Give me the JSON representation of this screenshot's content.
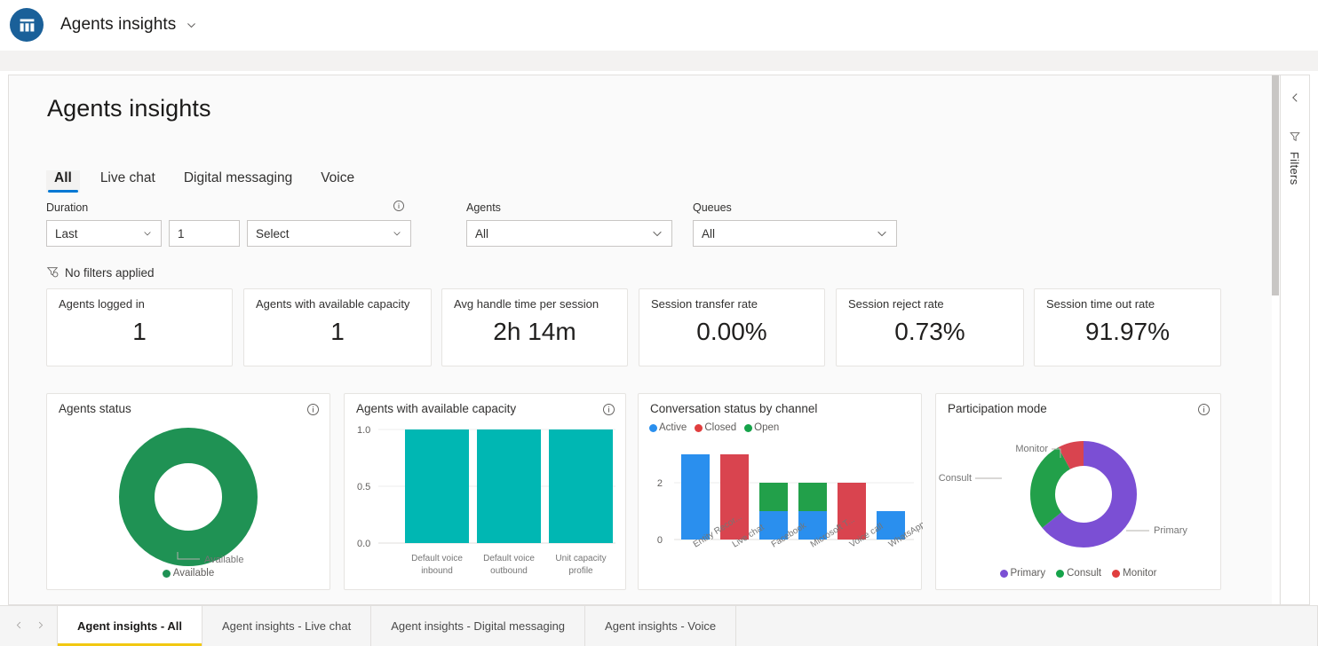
{
  "app": {
    "title": "Agents insights",
    "logo_icon": "analytics-bar-chart-icon",
    "chevron_icon": "chevron-down-icon"
  },
  "page": {
    "title": "Agents insights"
  },
  "tabs": [
    {
      "label": "All",
      "selected": true
    },
    {
      "label": "Live chat",
      "selected": false
    },
    {
      "label": "Digital messaging",
      "selected": false
    },
    {
      "label": "Voice",
      "selected": false
    }
  ],
  "filters": {
    "duration": {
      "label": "Duration",
      "info_icon": "info-icon",
      "operator_value": "Last",
      "number_value": "1",
      "unit_value": "Select",
      "unit_placeholder": "Select"
    },
    "agents": {
      "label": "Agents",
      "value": "All"
    },
    "queues": {
      "label": "Queues",
      "value": "All"
    },
    "applied_text": "No filters applied",
    "applied_icon": "filter-clock-icon"
  },
  "kpis": [
    {
      "label": "Agents logged in",
      "value": "1"
    },
    {
      "label": "Agents with available capacity",
      "value": "1"
    },
    {
      "label": "Avg handle time per session",
      "value": "2h 14m"
    },
    {
      "label": "Session transfer rate",
      "value": "0.00%"
    },
    {
      "label": "Session reject rate",
      "value": "0.73%"
    },
    {
      "label": "Session time out rate",
      "value": "91.97%"
    }
  ],
  "colors": {
    "accent": "#0078d4",
    "teal": "#00b7b3",
    "green": "#13a10e",
    "donut_green": "#1f9254",
    "blue": "#2a8fee",
    "red": "#d9444f",
    "bar_green": "#22a04a",
    "purple": "#7b4fd4",
    "legend_green": "#16a34a",
    "legend_red": "#e03e3e",
    "tab_underline": "#f2c811"
  },
  "chart_data": [
    {
      "id": "agents-status",
      "type": "pie",
      "title": "Agents status",
      "info_icon": "info-icon",
      "labels": [
        "Available"
      ],
      "values": [
        1
      ],
      "colors": [
        "#1f9254"
      ],
      "callout_label": "Available",
      "legend": [
        "Available"
      ],
      "legend_position": "bottom"
    },
    {
      "id": "agents-with-available-capacity",
      "type": "bar",
      "title": "Agents with available capacity",
      "info_icon": "info-icon",
      "categories": [
        "Default voice inbound",
        "Default voice outbound",
        "Unit capacity profile"
      ],
      "values": [
        1.0,
        1.0,
        1.0
      ],
      "color": "#00b7b3",
      "ylim": [
        0.0,
        1.0
      ],
      "yticks": [
        "0.0",
        "0.5",
        "1.0"
      ],
      "xlabel": "",
      "ylabel": "",
      "grid": true
    },
    {
      "id": "conversation-status-by-channel",
      "type": "bar",
      "title": "Conversation status by channel",
      "stacked": true,
      "categories": [
        "Entity Recor...",
        "Live chat",
        "Facebook",
        "Microsoft T...",
        "Voice call",
        "WhatsApp"
      ],
      "series": [
        {
          "name": "Active",
          "color": "#2a8fee",
          "values": [
            3,
            0,
            1,
            1,
            0,
            1
          ]
        },
        {
          "name": "Closed",
          "color": "#d9444f",
          "values": [
            0,
            3,
            0,
            0,
            2,
            0
          ]
        },
        {
          "name": "Open",
          "color": "#22a04a",
          "values": [
            0,
            0,
            1,
            1,
            0,
            0
          ]
        }
      ],
      "legend": [
        "Active",
        "Closed",
        "Open"
      ],
      "legend_position": "top",
      "ylim": [
        0,
        3
      ],
      "yticks": [
        "0",
        "2"
      ],
      "grid": true
    },
    {
      "id": "participation-mode",
      "type": "pie",
      "title": "Participation mode",
      "info_icon": "info-icon",
      "labels": [
        "Primary",
        "Consult",
        "Monitor"
      ],
      "values": [
        64,
        28,
        8
      ],
      "colors": [
        "#7b4fd4",
        "#22a04a",
        "#d9444f"
      ],
      "callouts": [
        "Monitor",
        "Consult",
        "Primary"
      ],
      "legend": [
        "Primary",
        "Consult",
        "Monitor"
      ],
      "legend_position": "bottom"
    }
  ],
  "rail": {
    "collapse_icon": "chevron-left-icon",
    "filter_icon": "filter-icon",
    "label": "Filters"
  },
  "bottom_tabs": {
    "prev_icon": "chevron-left-icon",
    "next_icon": "chevron-right-icon",
    "items": [
      {
        "label": "Agent insights - All",
        "selected": true
      },
      {
        "label": "Agent insights - Live chat",
        "selected": false
      },
      {
        "label": "Agent insights - Digital messaging",
        "selected": false
      },
      {
        "label": "Agent insights - Voice",
        "selected": false
      }
    ]
  }
}
